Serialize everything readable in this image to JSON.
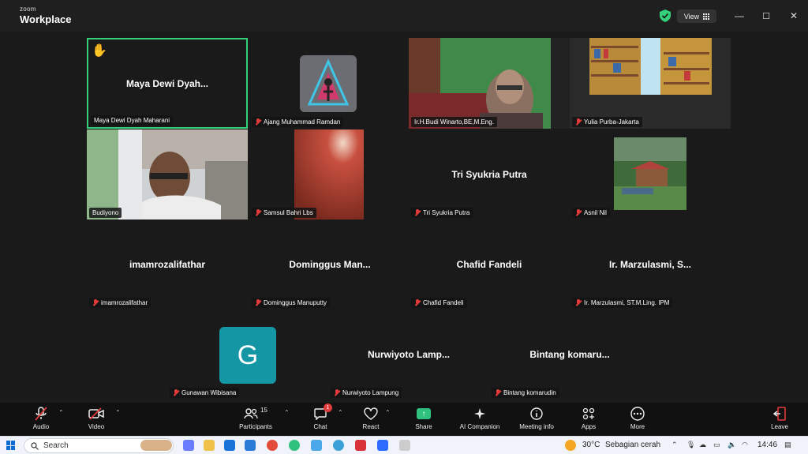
{
  "app": {
    "brand_small": "zoom",
    "brand_name": "Workplace"
  },
  "titlebar": {
    "view_label": "View",
    "minimize": "—",
    "maximize": "☐",
    "close": "✕"
  },
  "participants": [
    {
      "name": "Maya Dewi Dyah Maharani",
      "center": "Maya Dewi Dyah...",
      "muted": false,
      "hand": "✋",
      "active": true
    },
    {
      "name": "Ajang Muhammad Ramdan",
      "center": "",
      "muted": true
    },
    {
      "name": "Ir.H.Budi Winarto,BE,M.Eng.",
      "center": "",
      "muted": false
    },
    {
      "name": "Yulia Purba-Jakarta",
      "center": "",
      "muted": true
    },
    {
      "name": "Budiyono",
      "center": "",
      "muted": false
    },
    {
      "name": "Samsul Bahri Lbs",
      "center": "",
      "muted": true
    },
    {
      "name": "Tri Syukria Putra",
      "center": "Tri Syukria Putra",
      "muted": true
    },
    {
      "name": "Asnil Nil",
      "center": "",
      "muted": true
    },
    {
      "name": "imamrozalifathar",
      "center": "imamrozalifathar",
      "muted": true
    },
    {
      "name": "Dominggus Manuputty",
      "center": "Dominggus  Man...",
      "muted": true
    },
    {
      "name": "Chafid Fandeli",
      "center": "Chafid Fandeli",
      "muted": true
    },
    {
      "name": "Ir. Marzulasmi, ST.M.Ling. IPM",
      "center": "Ir. Marzulasmi,  S...",
      "muted": true
    },
    {
      "name": "Gunawan Wibisana",
      "center": "",
      "avatar_letter": "G",
      "muted": true
    },
    {
      "name": "Nurwiyoto Lampung",
      "center": "Nurwiyoto  Lamp...",
      "muted": true
    },
    {
      "name": "Bintang komarudin",
      "center": "Bintang  komaru...",
      "muted": true
    }
  ],
  "toolbar": {
    "audio": "Audio",
    "video": "Video",
    "participants": "Participants",
    "participants_count": "15",
    "chat": "Chat",
    "chat_badge": "1",
    "react": "React",
    "share": "Share",
    "ai_companion": "AI Companion",
    "meeting_info": "Meeting info",
    "apps": "Apps",
    "more": "More",
    "leave": "Leave"
  },
  "taskbar": {
    "search": "Search",
    "temp": "30°C",
    "weather": "Sebagian cerah",
    "time": "14:46"
  },
  "colors": {
    "active_border": "#35d17a",
    "muted": "#e23b3b",
    "avatar_bg": "#1596a4",
    "share": "#2ec27e"
  }
}
